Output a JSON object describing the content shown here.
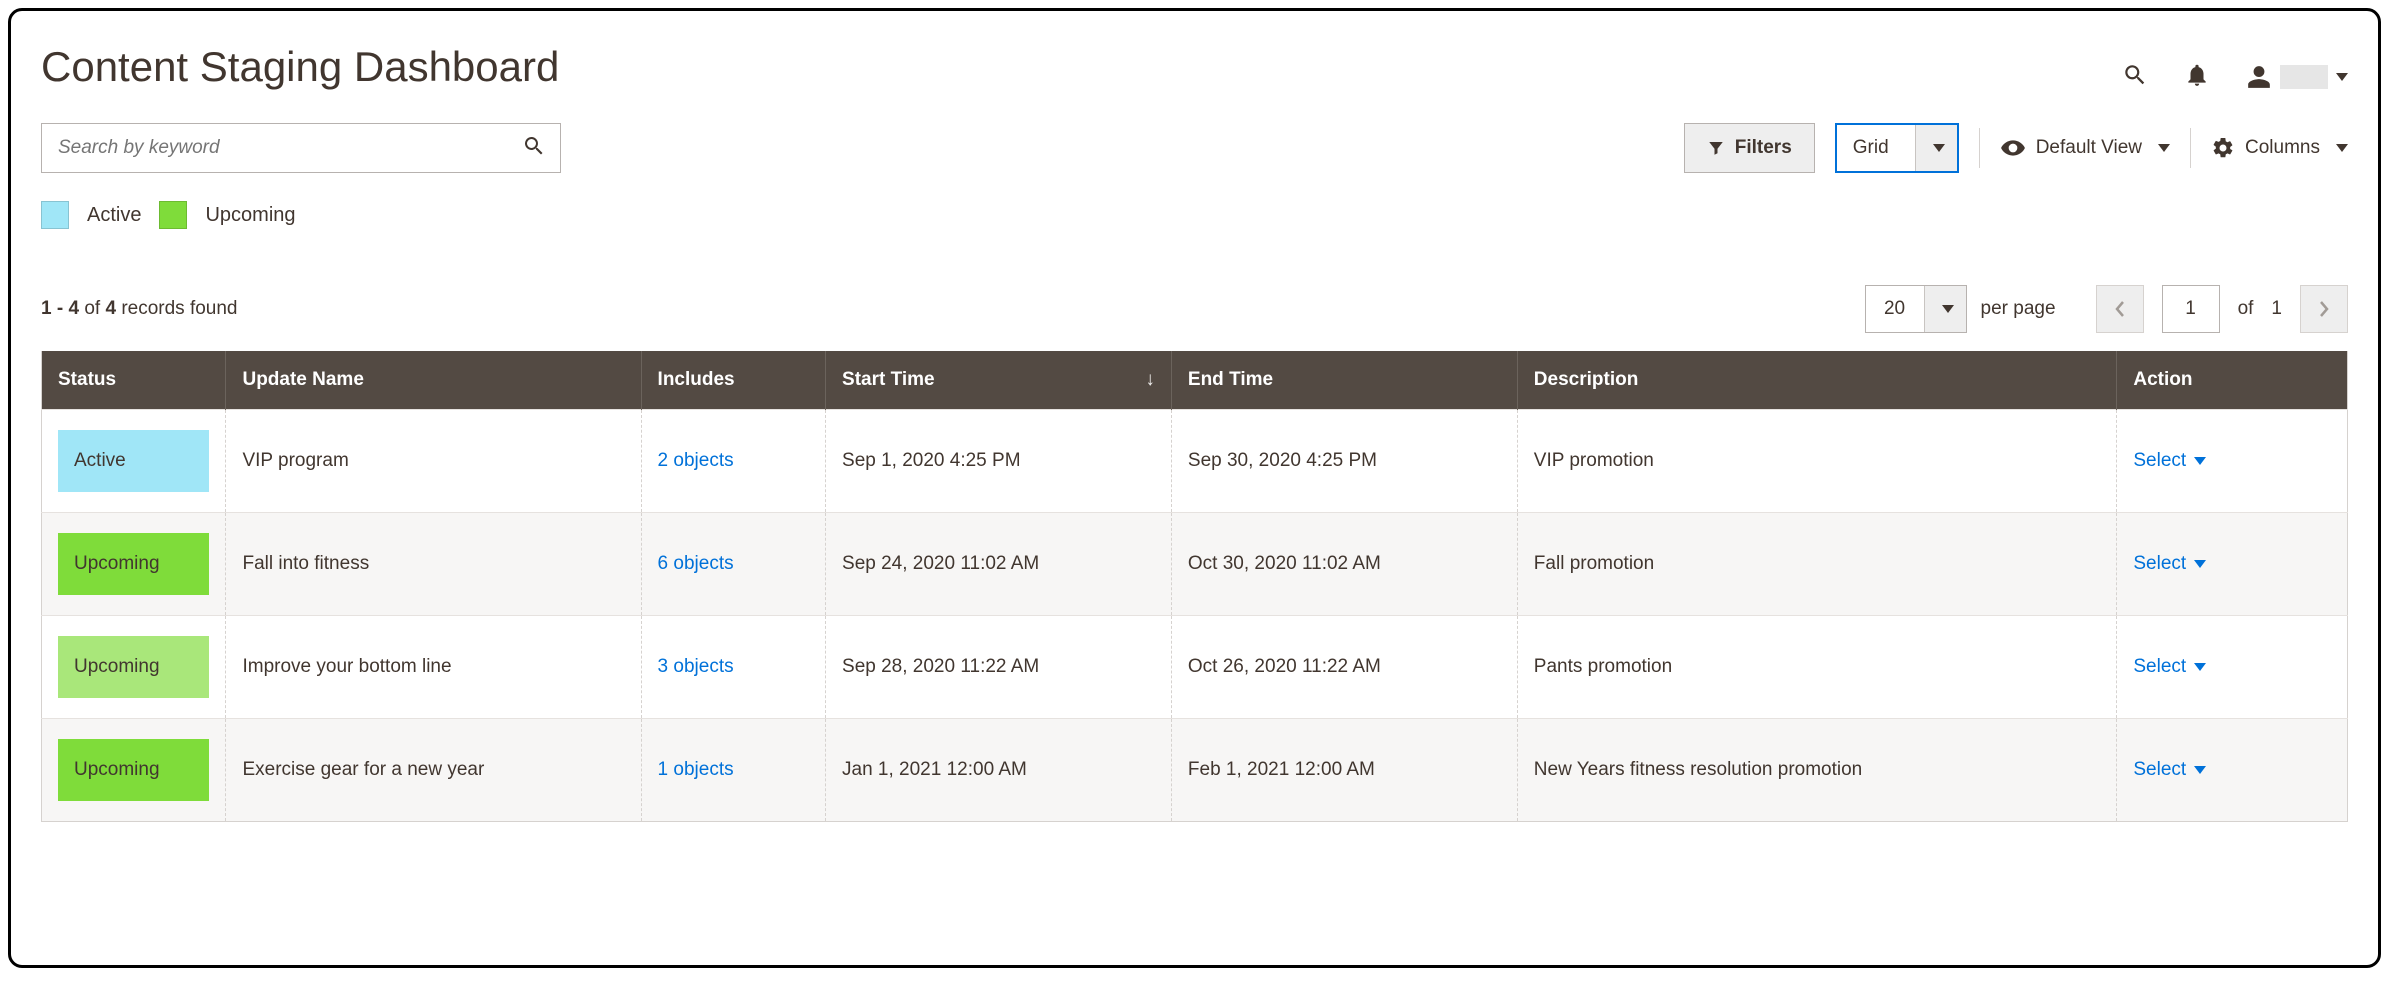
{
  "page_title": "Content Staging Dashboard",
  "search_placeholder": "Search by keyword",
  "toolbar": {
    "filters_label": "Filters",
    "view_mode": "Grid",
    "default_view_label": "Default View",
    "columns_label": "Columns"
  },
  "legend": {
    "active": "Active",
    "upcoming": "Upcoming",
    "colors": {
      "active": "#a0e6f7",
      "upcoming": "#7fdc3a"
    }
  },
  "records": {
    "range": "1 - 4",
    "of_word": "of",
    "total": "4",
    "suffix": "records found"
  },
  "pagination": {
    "page_size": "20",
    "per_page_label": "per page",
    "current_page": "1",
    "of_word": "of",
    "total_pages": "1"
  },
  "columns": {
    "status": "Status",
    "name": "Update Name",
    "includes": "Includes",
    "start": "Start Time",
    "end": "End Time",
    "desc": "Description",
    "action": "Action",
    "sorted": "start",
    "sort_dir": "↓"
  },
  "action_label": "Select",
  "rows": [
    {
      "status": "Active",
      "status_class": "status-active",
      "name": "VIP program",
      "includes": "2 objects",
      "start": "Sep 1, 2020 4:25 PM",
      "end": "Sep 30, 2020 4:25 PM",
      "desc": "VIP promotion"
    },
    {
      "status": "Upcoming",
      "status_class": "status-upcoming-0",
      "name": "Fall into fitness",
      "includes": "6 objects",
      "start": "Sep 24, 2020 11:02 AM",
      "end": "Oct 30, 2020 11:02 AM",
      "desc": "Fall promotion"
    },
    {
      "status": "Upcoming",
      "status_class": "status-upcoming-1",
      "name": "Improve your bottom line",
      "includes": "3 objects",
      "start": "Sep 28, 2020 11:22 AM",
      "end": "Oct 26, 2020 11:22 AM",
      "desc": "Pants promotion"
    },
    {
      "status": "Upcoming",
      "status_class": "status-upcoming-2",
      "name": "Exercise gear for a new year",
      "includes": "1 objects",
      "start": "Jan 1, 2021 12:00 AM",
      "end": "Feb 1, 2021 12:00 AM",
      "desc": "New Years fitness resolution promotion"
    }
  ]
}
